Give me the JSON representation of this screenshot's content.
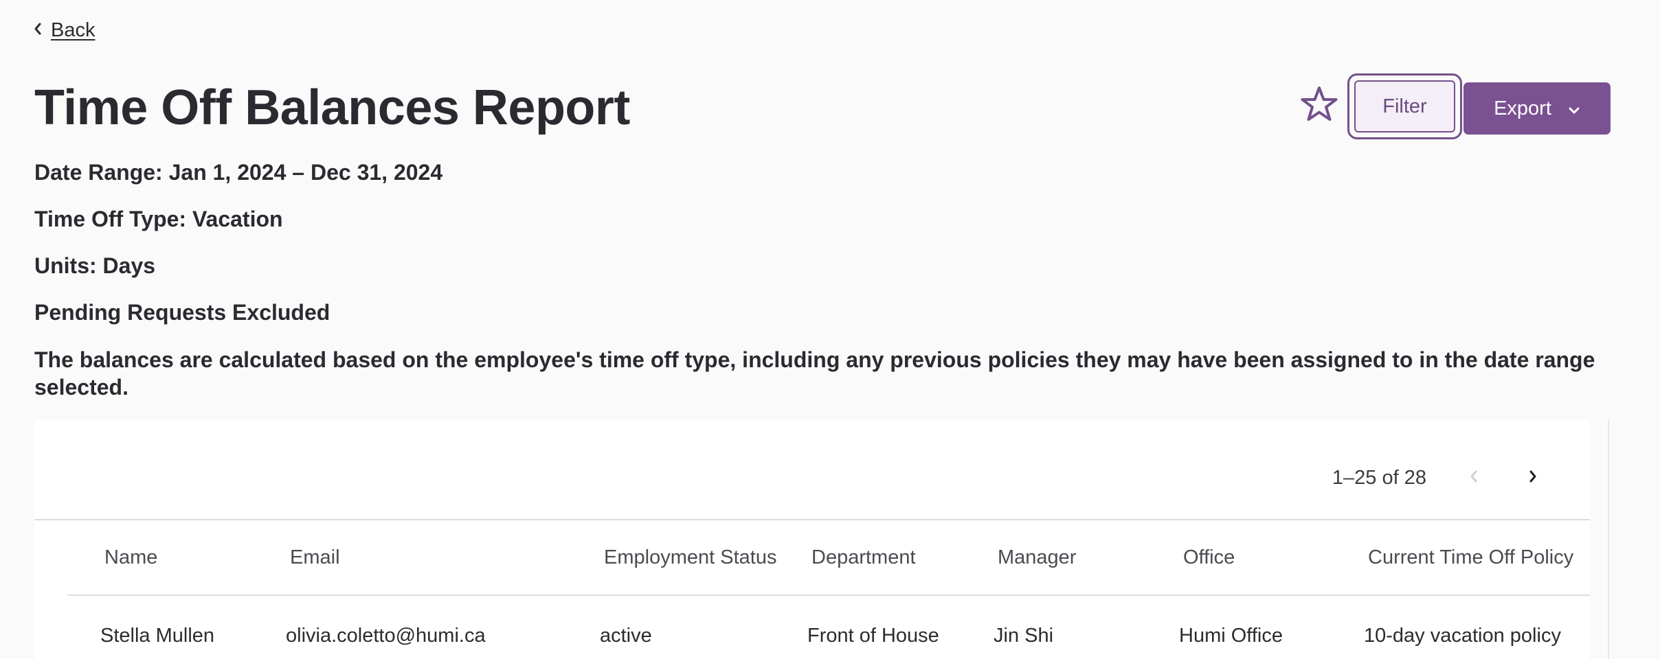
{
  "back": {
    "label": "Back"
  },
  "header": {
    "title": "Time Off Balances Report",
    "filter_label": "Filter",
    "export_label": "Export"
  },
  "meta": {
    "date_range": "Date Range: Jan 1, 2024 – Dec 31, 2024",
    "time_off_type": "Time Off Type: Vacation",
    "units": "Units: Days",
    "pending": "Pending Requests Excluded",
    "note": "The balances are calculated based on the employee's time off type, including any previous policies they may have been assigned to in the date range selected."
  },
  "pagination": {
    "range": "1–25 of 28"
  },
  "table": {
    "columns": [
      "Name",
      "Email",
      "Employment Status",
      "Department",
      "Manager",
      "Office",
      "Current Time Off Policy"
    ],
    "rows": [
      [
        "Stella Mullen",
        "olivia.coletto@humi.ca",
        "active",
        "Front of House",
        "Jin Shi",
        "Humi Office",
        "10-day vacation policy"
      ]
    ]
  },
  "colors": {
    "accent": "#7a5191",
    "accent_dark": "#73508c",
    "background": "#fafafa"
  },
  "icons": {
    "back": "chevron-left-icon",
    "favorite": "star-outline-icon",
    "export_caret": "chevron-down-icon",
    "prev": "chevron-left-icon",
    "next": "chevron-right-icon"
  }
}
